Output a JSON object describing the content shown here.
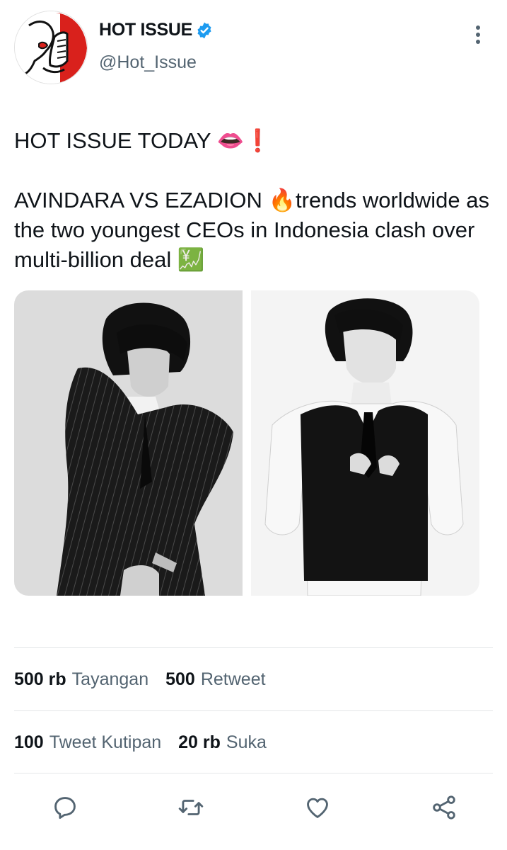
{
  "author": {
    "display_name": "HOT ISSUE",
    "handle": "@Hot_Issue",
    "verified": true,
    "avatar_icon": "whisper-lips-icon"
  },
  "tweet": {
    "text": "HOT ISSUE TODAY 👄❗\n\nAVINDARA VS EZADION 🔥trends worldwide as the two youngest CEOs in Indonesia clash over multi-billion deal 💹"
  },
  "media": [
    {
      "alt": "man in pinstripe suit"
    },
    {
      "alt": "man in black vest and tie"
    }
  ],
  "stats_row1": [
    {
      "value": "500 rb",
      "label": "Tayangan"
    },
    {
      "value": "500",
      "label": "Retweet"
    }
  ],
  "stats_row2": [
    {
      "value": "100",
      "label": "Tweet Kutipan"
    },
    {
      "value": "20 rb",
      "label": "Suka"
    }
  ],
  "actions": [
    "reply-icon",
    "retweet-icon",
    "like-icon",
    "share-icon"
  ],
  "colors": {
    "text": "#0f1419",
    "secondary": "#536471",
    "verified": "#1d9bf0",
    "icon": "#536471",
    "avatar_red": "#d9211c"
  }
}
